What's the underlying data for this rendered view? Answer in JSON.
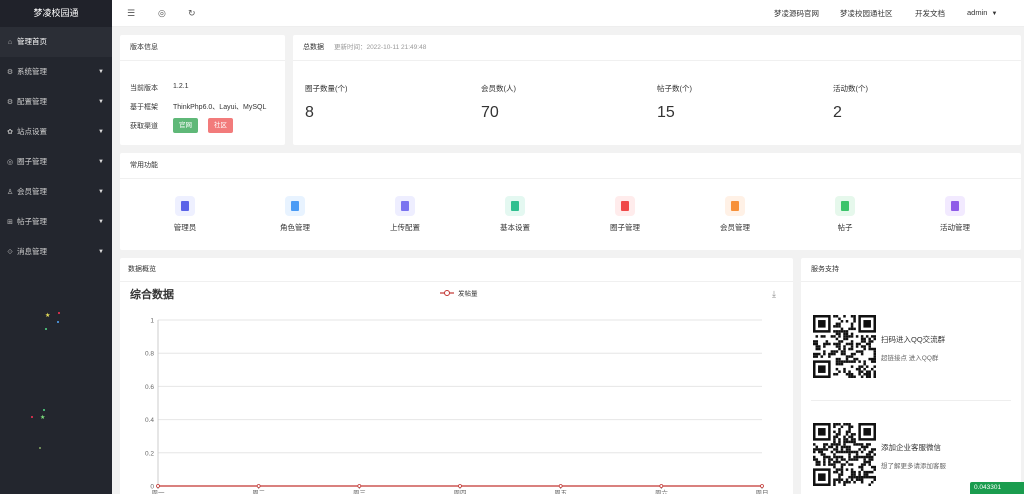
{
  "app": {
    "title": "梦凌校园通"
  },
  "sidebar": {
    "items": [
      {
        "label": "管理首页",
        "icon": "home-icon",
        "glyph": "⌂",
        "has_children": false
      },
      {
        "label": "系统管理",
        "icon": "gear-icon",
        "glyph": "⚙",
        "has_children": true
      },
      {
        "label": "配置管理",
        "icon": "settings-icon",
        "glyph": "⚙",
        "has_children": true
      },
      {
        "label": "站点设置",
        "icon": "site-icon",
        "glyph": "✿",
        "has_children": true
      },
      {
        "label": "圈子管理",
        "icon": "circle-icon",
        "glyph": "◎",
        "has_children": true
      },
      {
        "label": "会员管理",
        "icon": "user-icon",
        "glyph": "♙",
        "has_children": true
      },
      {
        "label": "帖子管理",
        "icon": "cart-icon",
        "glyph": "⊞",
        "has_children": true
      },
      {
        "label": "消息管理",
        "icon": "message-icon",
        "glyph": "⟐",
        "has_children": true
      }
    ]
  },
  "header": {
    "icons": [
      "menu-toggle-icon",
      "globe-icon",
      "refresh-icon"
    ],
    "links": [
      "梦凌源码官网",
      "梦凌校园通社区",
      "开发文档"
    ],
    "user": "admin"
  },
  "version_card": {
    "title": "版本信息",
    "rows": [
      {
        "label": "当前版本",
        "value": "1.2.1"
      },
      {
        "label": "基于框架",
        "value": "ThinkPhp6.0、Layui、MySQL"
      },
      {
        "label": "获取渠道",
        "value": ""
      }
    ],
    "buttons": [
      {
        "label": "官网",
        "color": "#5fb878"
      },
      {
        "label": "社区",
        "color": "#f27b7b"
      }
    ]
  },
  "stats_card": {
    "title": "总数据",
    "updated": "更新时间：2022-10-11 21:49:48",
    "items": [
      {
        "label": "圈子数量(个)",
        "value": "8"
      },
      {
        "label": "会员数(人)",
        "value": "70"
      },
      {
        "label": "帖子数(个)",
        "value": "15"
      },
      {
        "label": "活动数(个)",
        "value": "2"
      }
    ]
  },
  "functions_card": {
    "title": "常用功能",
    "items": [
      {
        "label": "管理员",
        "icon": "admin-icon",
        "bg": "#eef0ff",
        "fg": "#5b63e8"
      },
      {
        "label": "角色管理",
        "icon": "role-icon",
        "bg": "#e8f3ff",
        "fg": "#4a9bf5"
      },
      {
        "label": "上传配置",
        "icon": "upload-config-icon",
        "bg": "#eeeeff",
        "fg": "#7a73f0"
      },
      {
        "label": "基本设置",
        "icon": "basic-settings-icon",
        "bg": "#e4f8f1",
        "fg": "#2fbf8f"
      },
      {
        "label": "圈子管理",
        "icon": "circle-manage-icon",
        "bg": "#ffecec",
        "fg": "#f04848"
      },
      {
        "label": "会员管理",
        "icon": "member-manage-icon",
        "bg": "#fff1e6",
        "fg": "#f7913a"
      },
      {
        "label": "帖子",
        "icon": "post-icon",
        "bg": "#e6f8ec",
        "fg": "#3cc46a"
      },
      {
        "label": "活动管理",
        "icon": "activity-manage-icon",
        "bg": "#f2eaff",
        "fg": "#8f5be8"
      }
    ]
  },
  "overview_card": {
    "title": "数据概览",
    "chart_title": "综合数据",
    "download_icon": "download-icon"
  },
  "chart_data": {
    "type": "line",
    "title": "综合数据",
    "categories": [
      "周一",
      "周二",
      "周三",
      "周四",
      "周五",
      "周六",
      "周日"
    ],
    "series": [
      {
        "name": "发帖量",
        "values": [
          0,
          0,
          0,
          0,
          0,
          0,
          0
        ],
        "color": "#c23531"
      }
    ],
    "ylim": [
      0,
      1
    ],
    "yticks": [
      "0",
      "0.2",
      "0.4",
      "0.6",
      "0.8",
      "1"
    ],
    "legend": "top-center",
    "grid": true
  },
  "support_card": {
    "title": "服务支持",
    "entries": [
      {
        "title": "扫码进入QQ交流群",
        "sub": "超链接点 进入QQ群"
      },
      {
        "title": "添加企业客服微信",
        "sub": "想了解更多请添加客服"
      }
    ]
  },
  "badge": {
    "text": "0.043301"
  }
}
